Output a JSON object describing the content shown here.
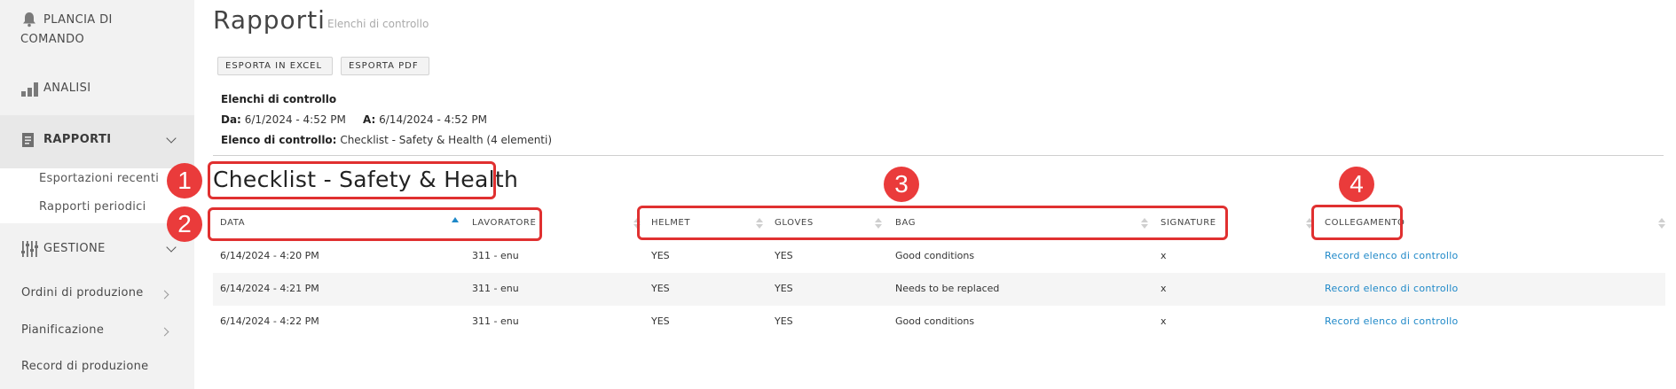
{
  "sidebar": {
    "dashboard": "PLANCIA DI COMANDO",
    "analisi": "ANALISI",
    "rapporti": "RAPPORTI",
    "rapporti_sub": [
      "Esportazioni recenti",
      "Rapporti periodici"
    ],
    "gestione": "GESTIONE",
    "links": [
      "Ordini di produzione",
      "Pianificazione",
      "Record di produzione"
    ]
  },
  "page": {
    "title": "Rapporti",
    "subtitle": "Elenchi di controllo"
  },
  "toolbar": {
    "export_excel": "ESPORTA IN EXCEL",
    "export_pdf": "ESPORTA PDF"
  },
  "report_info": {
    "heading": "Elenchi di controllo",
    "from_label": "Da:",
    "from_value": "6/1/2024 - 4:52 PM",
    "to_label": "A:",
    "to_value": "6/14/2024 - 4:52 PM",
    "checklist_label": "Elenco di controllo:",
    "checklist_value": "Checklist - Safety & Health (4 elementi)"
  },
  "checklist_title": "Checklist - Safety & Health",
  "table": {
    "columns": [
      "DATA",
      "LAVORATORE",
      "HELMET",
      "GLOVES",
      "BAG",
      "SIGNATURE",
      "COLLEGAMENTO"
    ],
    "sorted_column": "DATA",
    "rows": [
      [
        "6/14/2024 - 4:20 PM",
        "311 - enu",
        "YES",
        "YES",
        "Good conditions",
        "x",
        "Record elenco di controllo"
      ],
      [
        "6/14/2024 - 4:21 PM",
        "311 - enu",
        "YES",
        "YES",
        "Needs to be replaced",
        "x",
        "Record elenco di controllo"
      ],
      [
        "6/14/2024 - 4:22 PM",
        "311 - enu",
        "YES",
        "YES",
        "Good conditions",
        "x",
        "Record elenco di controllo"
      ]
    ]
  },
  "annotations": [
    "1",
    "2",
    "3",
    "4"
  ],
  "colors": {
    "accent": "#1e88c8",
    "annotation": "#ea3b3b",
    "sidebar_bg": "#f2f2f2"
  }
}
